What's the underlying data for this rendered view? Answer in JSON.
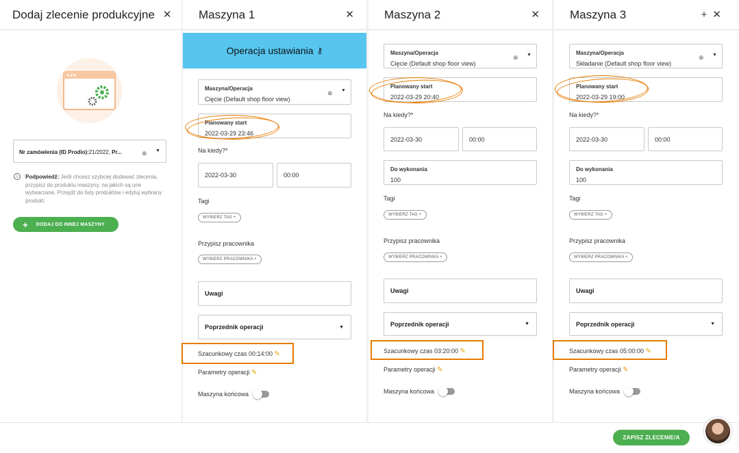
{
  "panel0": {
    "title": "Dodaj zlecenie produkcyjne",
    "order_field_label": "Nr zamówienia (ID Prodio):",
    "order_field_value": "21/2022,",
    "order_field_extra": "Pr...",
    "hint_bold": "Podpowiedź:",
    "hint_text": "Jeśli chcesz szybciej dodawać zlecenia, przypisz do produktu maszyny, na jakich są one wytwarzane. Przejdź do listy produktów i edytuj wybrany produkt.",
    "add_button_label": "DODAJ DO INNEJ MASZYNY"
  },
  "panel1": {
    "title": "Maszyna 1",
    "banner_label": "Operacja ustawiania",
    "machine_label": "Maszyna/Operacja",
    "machine_value": "Cięcie   (Default shop floor view)",
    "start_label": "Planowany start",
    "start_value": "2022-03-29 23:46",
    "when_label": "Na kiedy?*",
    "date_value": "2022-03-30",
    "time_value": "00:00",
    "tags_label": "Tagi",
    "tag_chip": "WYBIERZ TAG +",
    "worker_label": "Przypisz pracownika",
    "worker_chip": "WYBIERZ PRACOWNIKA +",
    "notes_label": "Uwagi",
    "predecessor_label": "Poprzednik operacji",
    "estimate_label": "Szacunkowy czas 00:14:00",
    "params_label": "Parametry operacji",
    "final_label": "Maszyna końcowa"
  },
  "panel2": {
    "title": "Maszyna 2",
    "machine_label": "Maszyna/Operacja",
    "machine_value": "Cięcie   (Default shop floor view)",
    "start_label": "Planowany start",
    "start_value": "2022-03-29 20:40",
    "when_label": "Na kiedy?*",
    "date_value": "2022-03-30",
    "time_value": "00:00",
    "todo_label": "Do wykonania",
    "todo_value": "100",
    "tags_label": "Tagi",
    "tag_chip": "WYBIERZ TAG +",
    "worker_label": "Przypisz pracownika",
    "worker_chip": "WYBIERZ PRACOWNIKA +",
    "notes_label": "Uwagi",
    "predecessor_label": "Poprzednik operacji",
    "estimate_label": "Szacunkowy czas 03:20:00",
    "params_label": "Parametry operacji",
    "final_label": "Maszyna końcowa"
  },
  "panel3": {
    "title": "Maszyna 3",
    "machine_label": "Maszyna/Operacja",
    "machine_value": "Składanie   (Default shop floor view)",
    "start_label": "Planowany start",
    "start_value": "2022-03-29 19:00",
    "when_label": "Na kiedy?*",
    "date_value": "2022-03-30",
    "time_value": "00:00",
    "todo_label": "Do wykonania",
    "todo_value": "100",
    "tags_label": "Tagi",
    "tag_chip": "WYBIERZ TAG +",
    "worker_label": "Przypisz pracownika",
    "worker_chip": "WYBIERZ PRACOWNIKA +",
    "notes_label": "Uwagi",
    "predecessor_label": "Poprzednik operacji",
    "estimate_label": "Szacunkowy czas 05:00:00",
    "params_label": "Parametry operacji",
    "final_label": "Maszyna końcowa"
  },
  "footer": {
    "save_label": "ZAPISZ ZLECENIE/A"
  },
  "icons": {
    "close": "close-icon",
    "plus": "plus-icon",
    "key": "key-icon",
    "pencil": "pencil-icon"
  },
  "colors": {
    "banner": "#56c5f0",
    "primary_green": "#4caf50",
    "annotation_orange": "#e57a00",
    "pencil": "#e8a000"
  }
}
